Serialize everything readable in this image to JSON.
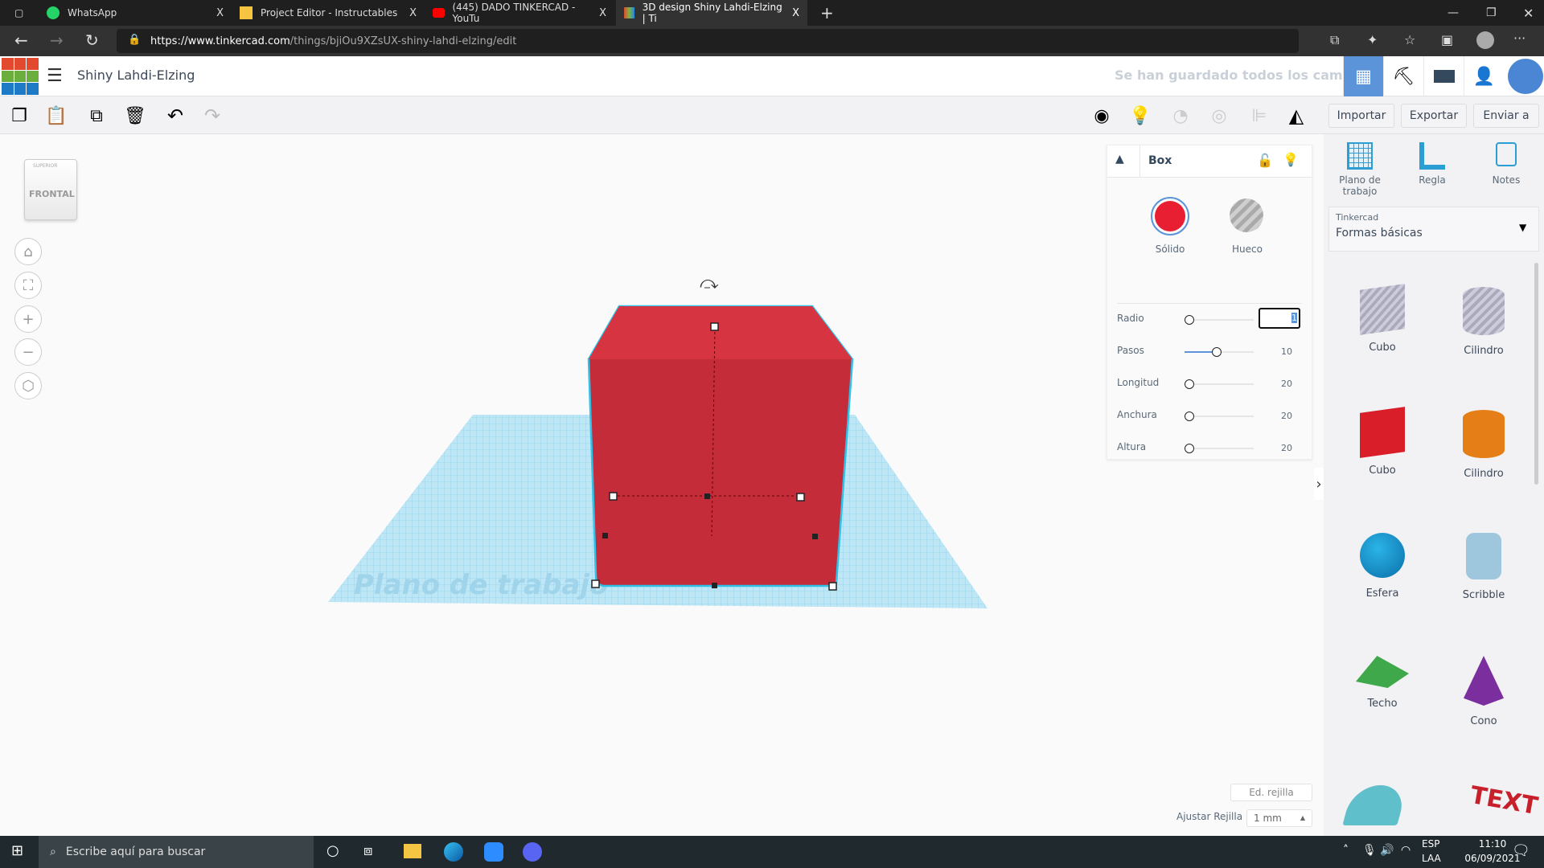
{
  "browser": {
    "tabs": [
      {
        "label": "WhatsApp",
        "icon": "whatsapp-icon"
      },
      {
        "label": "Project Editor - Instructables",
        "icon": "instructables-icon"
      },
      {
        "label": "(445) DADO TINKERCAD - YouTu",
        "icon": "youtube-icon"
      },
      {
        "label": "3D design Shiny Lahdi-Elzing | Ti",
        "icon": "tinkercad-icon",
        "active": true
      }
    ],
    "close": "X",
    "new_tab": "+",
    "url_host": "https://www.tinkercad.com",
    "url_path": "/things/bjiOu9XZsUX-shiny-lahdi-elzing/edit"
  },
  "app": {
    "logo": [
      "T",
      "I",
      "N",
      "K",
      "E",
      "R",
      "C",
      "A",
      "D"
    ],
    "title": "Shiny Lahdi-Elzing",
    "save_status": "Se han guardado todos los cambios.",
    "accent": "#5b94d8"
  },
  "toolbar": {
    "import": "Importar",
    "export": "Exportar",
    "send": "Enviar a"
  },
  "viewcube": {
    "face": "FRONTAL",
    "top": "SUPERIOR"
  },
  "workplane": {
    "label": "Plano de trabajo"
  },
  "inspector": {
    "title": "Box",
    "solid": "Sólido",
    "hole": "Hueco",
    "solid_color": "#e81e32",
    "params": [
      {
        "label": "Radio",
        "value": "1",
        "fraction": 0
      },
      {
        "label": "Pasos",
        "value": "10",
        "fraction": 0.4
      },
      {
        "label": "Longitud",
        "value": "20",
        "fraction": 0
      },
      {
        "label": "Anchura",
        "value": "20",
        "fraction": 0
      },
      {
        "label": "Altura",
        "value": "20",
        "fraction": 0
      }
    ]
  },
  "rpanel": {
    "tools": [
      {
        "label": "Plano de trabajo"
      },
      {
        "label": "Regla"
      },
      {
        "label": "Notes"
      }
    ],
    "library_caption": "Tinkercad",
    "library": "Formas básicas",
    "shapes": [
      {
        "label": "Cubo"
      },
      {
        "label": "Cilindro"
      },
      {
        "label": "Cubo"
      },
      {
        "label": "Cilindro"
      },
      {
        "label": "Esfera"
      },
      {
        "label": "Scribble"
      },
      {
        "label": "Techo"
      },
      {
        "label": "Cono"
      }
    ],
    "text_shape": "TEXT"
  },
  "grid": {
    "edit": "Ed. rejilla",
    "snap_label": "Ajustar Rejilla",
    "snap_value": "1 mm"
  },
  "taskbar": {
    "search": "Escribe aquí para buscar",
    "lang1": "ESP",
    "lang2": "LAA",
    "time": "11:10",
    "date": "06/09/2021"
  }
}
